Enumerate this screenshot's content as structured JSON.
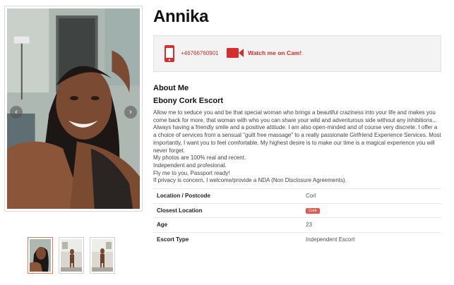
{
  "profile": {
    "name": "Annika",
    "phone": "+46766760901",
    "cam_link": "Watch me on Cam!",
    "about_heading": "About Me",
    "subtitle": "Ebony Cork Escort",
    "about_paragraphs": [
      "Allow me to seduce you and be that special woman who brings a beautiful craziness into your life and makes you come back for more, that woman with who you can share your wild and adventurous side without any inhibitions... Always having a friendly smile and a positive attitude. I am also open-minded and of course very discrete. I offer a a choice of services from a sensual \"guilt free massage\" to a really passionate Girlfriend Experience Services. Most importantly, I want you to feel comfortable. My highest desire is to make our time is a magical experience you will never forget.",
      "My photos are 100% real and recent.",
      "Independent and profesional.",
      "Fly me to you, Passport ready!",
      "If privacy is concern, I welcome/provide a NDA (Non Disclosure Agreements)."
    ],
    "details": [
      {
        "label": "Location / Postcode",
        "value": "Corl"
      },
      {
        "label": "Closest Location",
        "value": "Cork"
      },
      {
        "label": "Age",
        "value": "23"
      },
      {
        "label": "Escort Type",
        "value": "Independent Escort"
      }
    ]
  },
  "gallery": {
    "prev_icon": "chevron-left-icon",
    "next_icon": "chevron-right-icon",
    "prev_glyph": "‹",
    "next_glyph": "›",
    "thumbnail_count": 3,
    "active_thumbnail": 1
  },
  "colors": {
    "accent": "#d32f2f",
    "badge": "#e05a4f",
    "contact_bg": "#f3f3f3"
  }
}
